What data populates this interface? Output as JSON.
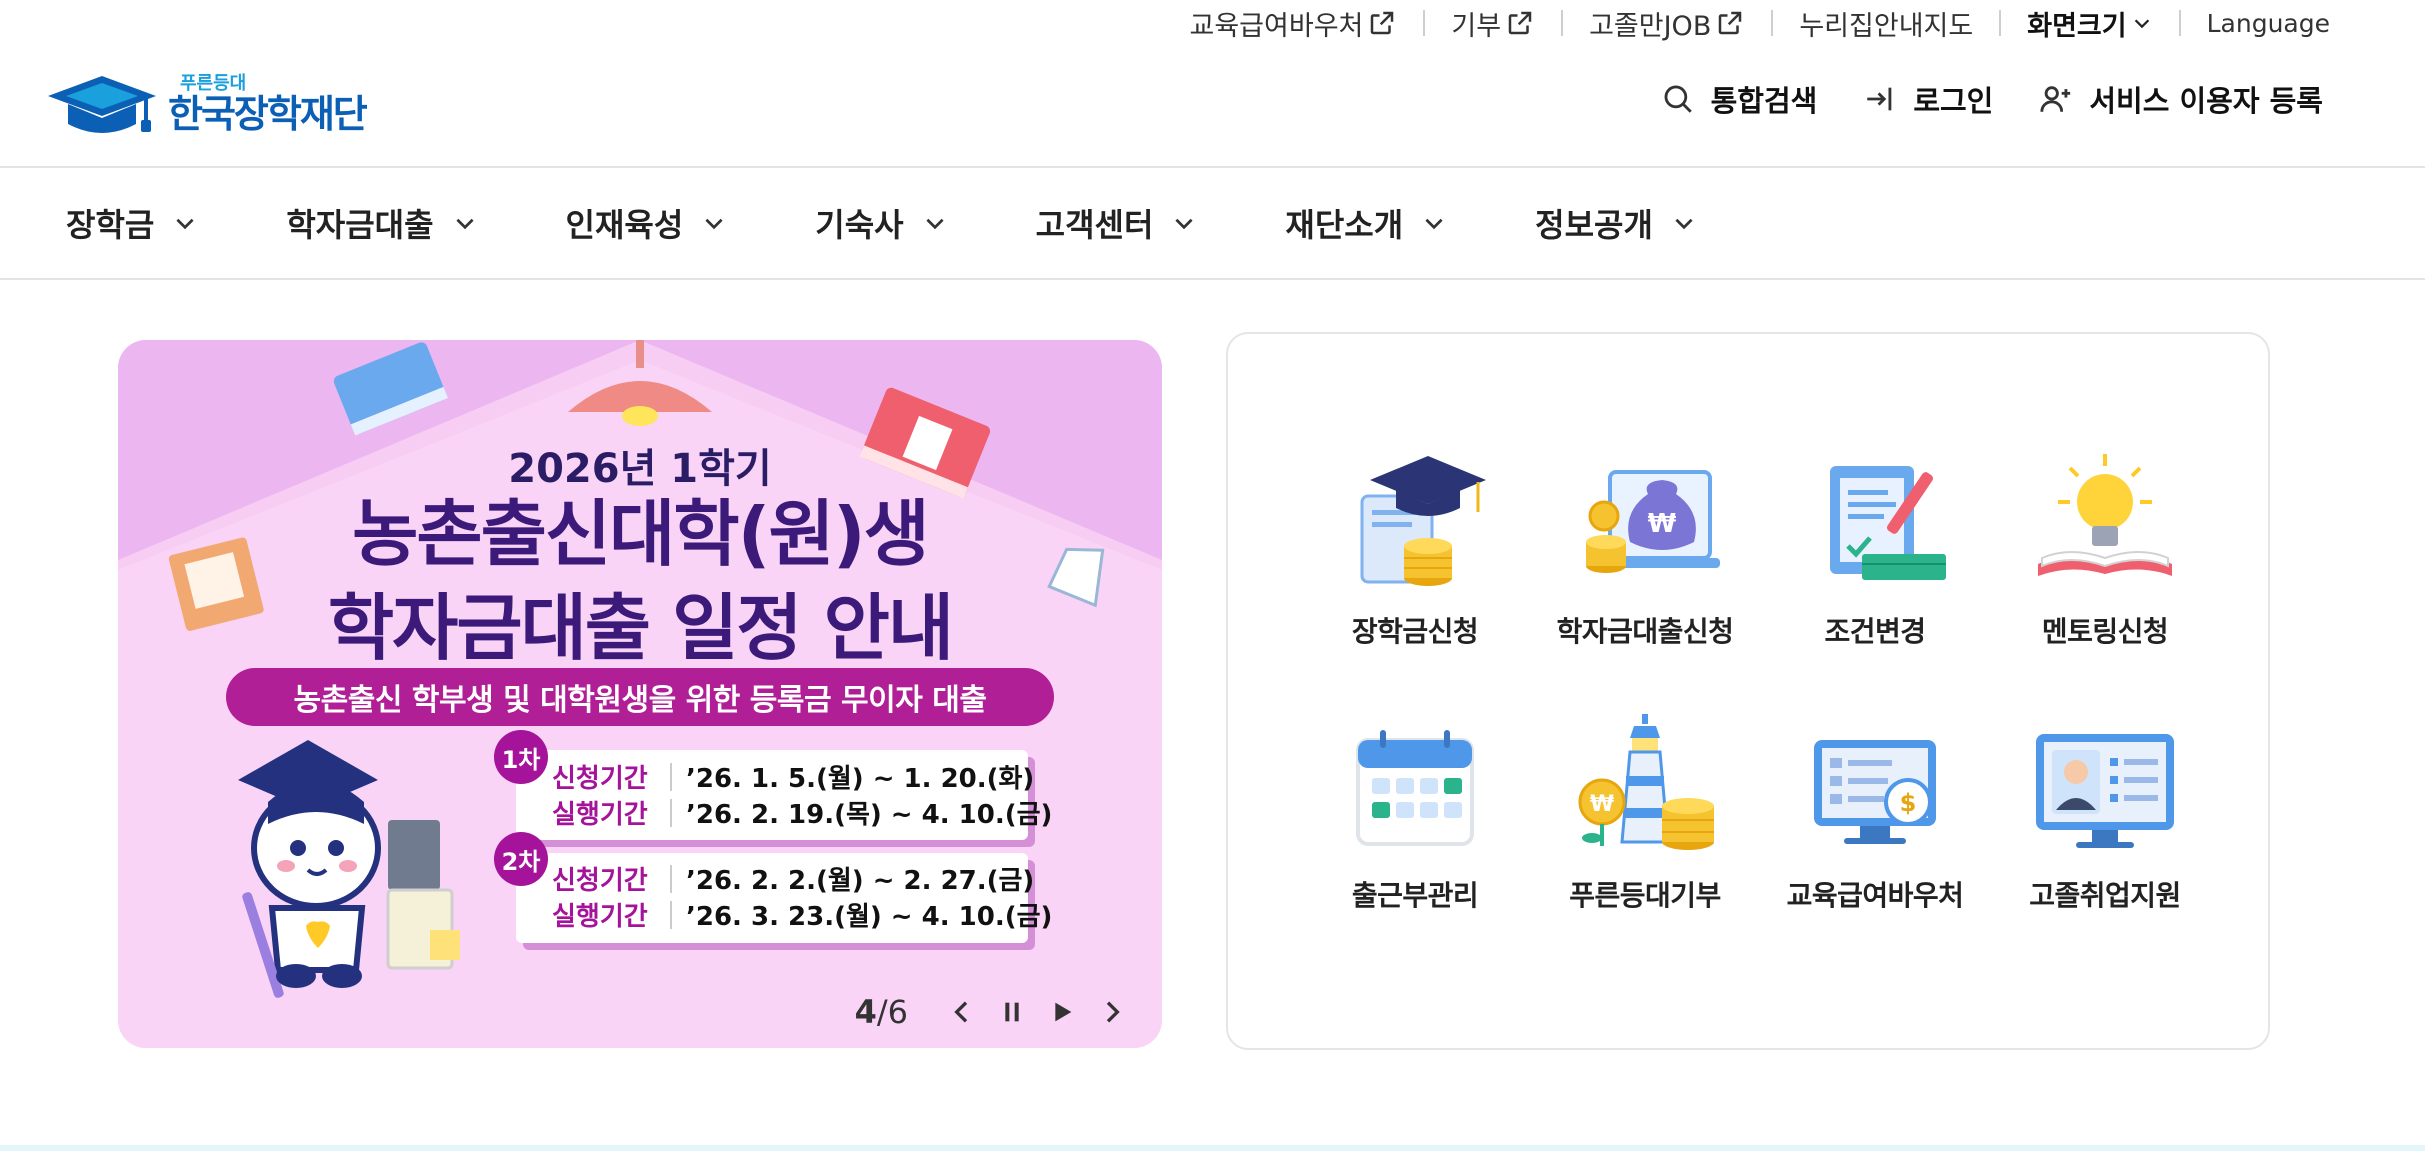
{
  "util_bar": {
    "items": [
      {
        "label": "교육급여바우처",
        "external": true
      },
      {
        "label": "기부",
        "external": true
      },
      {
        "label": "고졸만JOB",
        "external": true
      },
      {
        "label": "누리집안내지도",
        "external": false
      }
    ],
    "screen_size_label": "화면크기",
    "language_label": "Language"
  },
  "header": {
    "logo_sub": "푸른등대",
    "logo_main": "한국장학재단",
    "search_label": "통합검색",
    "login_label": "로그인",
    "register_label": "서비스 이용자 등록"
  },
  "gnb": {
    "items": [
      "장학금",
      "학자금대출",
      "인재육성",
      "기숙사",
      "고객센터",
      "재단소개",
      "정보공개"
    ]
  },
  "banner": {
    "year_text": "2026년 1학기",
    "title_line1": "농촌출신대학(원)생",
    "title_line2": "학자금대출 일정 안내",
    "pill_text": "농촌출신 학부생 및 대학원생을 위한 등록금 무이자 대출",
    "round1_badge": "1차",
    "round2_badge": "2차",
    "rows": [
      {
        "label": "신청기간",
        "value": "’26. 1. 5.(월) ~ 1. 20.(화)"
      },
      {
        "label": "실행기간",
        "value": "’26. 2. 19.(목) ~ 4. 10.(금)"
      },
      {
        "label": "신청기간",
        "value": "’26. 2. 2.(월) ~ 2. 27.(금)"
      },
      {
        "label": "실행기간",
        "value": "’26. 3. 23.(월) ~ 4. 10.(금)"
      }
    ],
    "current_page": "4",
    "total_pages": "/6",
    "colors": {
      "background": "#f7cdf3",
      "accent": "#a5139b",
      "title": "#3b1a7a"
    }
  },
  "quick_menu": {
    "items": [
      {
        "label": "장학금신청",
        "icon": "graduation-cap-coins-icon"
      },
      {
        "label": "학자금대출신청",
        "icon": "money-bag-laptop-icon"
      },
      {
        "label": "조건변경",
        "icon": "document-pen-icon"
      },
      {
        "label": "멘토링신청",
        "icon": "lightbulb-book-icon"
      },
      {
        "label": "출근부관리",
        "icon": "calendar-icon"
      },
      {
        "label": "푸른등대기부",
        "icon": "lighthouse-coins-icon"
      },
      {
        "label": "교육급여바우처",
        "icon": "monitor-dollar-icon"
      },
      {
        "label": "고졸취업지원",
        "icon": "profile-monitor-icon"
      }
    ]
  },
  "theme": {
    "brand_blue": "#0b5fb5",
    "brand_light_blue": "#1aa0dc"
  }
}
